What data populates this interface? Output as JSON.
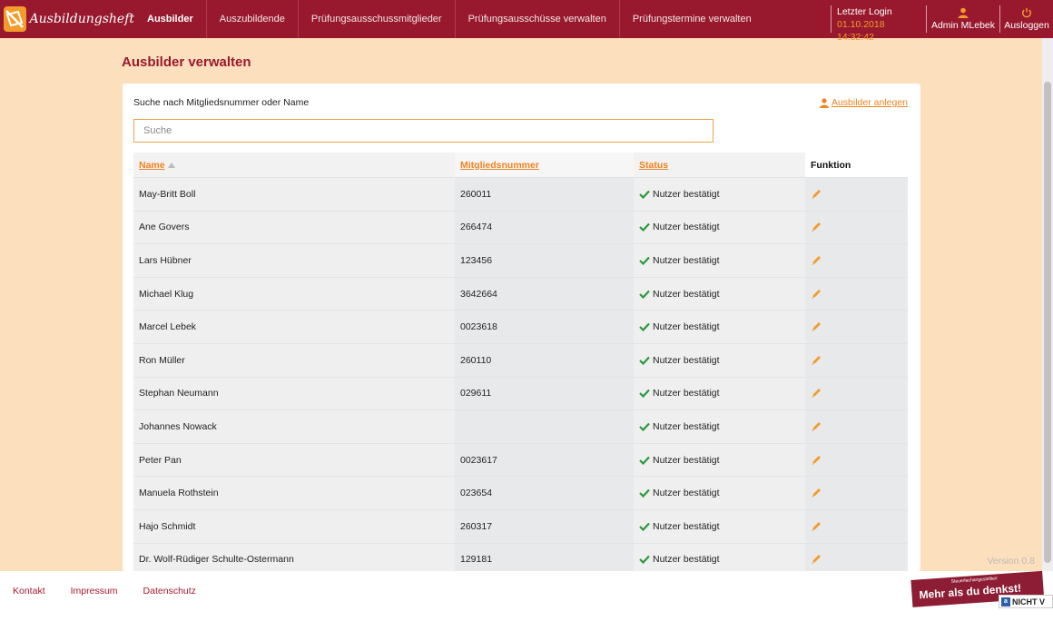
{
  "brand": {
    "name": "Ausbildungsheft"
  },
  "nav": {
    "items": [
      {
        "label": "Ausbilder",
        "active": true
      },
      {
        "label": "Auszubildende"
      },
      {
        "label": "Prüfungsausschussmitglieder"
      },
      {
        "label": "Prüfungsausschüsse verwalten"
      },
      {
        "label": "Prüfungstermine verwalten"
      }
    ]
  },
  "header": {
    "login_label": "Letzter Login",
    "login_time": "01.10.2018 14:32:42",
    "user": "Admin MLebek",
    "logout": "Ausloggen"
  },
  "page": {
    "title": "Ausbilder verwalten"
  },
  "search": {
    "label": "Suche nach Mitgliedsnummer oder Name",
    "placeholder": "Suche",
    "value": ""
  },
  "actions": {
    "add_label": "Ausbilder anlegen"
  },
  "table": {
    "headers": {
      "name": "Name",
      "nr": "Mitgliedsnummer",
      "status": "Status",
      "function": "Funktion"
    },
    "rows": [
      {
        "name": "May-Britt Boll",
        "nr": "260011",
        "status": "Nutzer bestätigt"
      },
      {
        "name": "Ane Govers",
        "nr": "266474",
        "status": "Nutzer bestätigt"
      },
      {
        "name": "Lars Hübner",
        "nr": "123456",
        "status": "Nutzer bestätigt"
      },
      {
        "name": "Michael Klug",
        "nr": "3642664",
        "status": "Nutzer bestätigt"
      },
      {
        "name": "Marcel Lebek",
        "nr": "0023618",
        "status": "Nutzer bestätigt"
      },
      {
        "name": "Ron Müller",
        "nr": "260110",
        "status": "Nutzer bestätigt"
      },
      {
        "name": "Stephan Neumann",
        "nr": "029611",
        "status": "Nutzer bestätigt"
      },
      {
        "name": "Johannes Nowack",
        "nr": "",
        "status": "Nutzer bestätigt"
      },
      {
        "name": "Peter Pan",
        "nr": "0023617",
        "status": "Nutzer bestätigt"
      },
      {
        "name": "Manuela Rothstein",
        "nr": "023654",
        "status": "Nutzer bestätigt"
      },
      {
        "name": "Hajo Schmidt",
        "nr": "260317",
        "status": "Nutzer bestätigt"
      },
      {
        "name": "Dr. Wolf-Rüdiger Schulte-Ostermann",
        "nr": "129181",
        "status": "Nutzer bestätigt"
      }
    ]
  },
  "version": "Version 0.8",
  "footer": {
    "links": [
      "Kontakt",
      "Impressum",
      "Datenschutz"
    ],
    "badge_small": "Steuerfachangestellte/r",
    "badge_text": "Mehr als du denkst!",
    "nicht_text": "NICHT V"
  },
  "colors": {
    "brand": "#98192e",
    "accent": "#f0831f",
    "background": "#fcdfbd",
    "status_ok": "#2a9a3a"
  },
  "icons": {
    "logo": "logo-icon",
    "user": "user-icon",
    "logout": "power-icon",
    "add": "user-add-icon",
    "sort": "sort-up-icon",
    "status": "check-icon",
    "edit": "pencil-icon"
  }
}
